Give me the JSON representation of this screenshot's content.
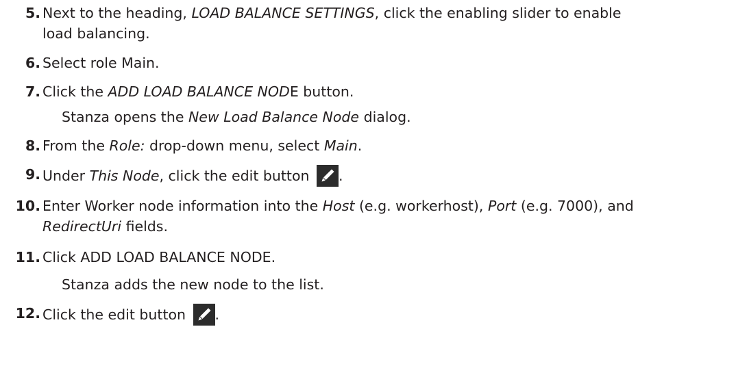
{
  "steps": [
    {
      "number": "5.",
      "parts": [
        {
          "t": "Next to the heading, "
        },
        {
          "t": "LOAD BALANCE SETTINGS",
          "i": true
        },
        {
          "t": ", click the enabling slider to enable"
        }
      ],
      "line2": [
        {
          "t": "load balancing."
        }
      ]
    },
    {
      "number": "6.",
      "parts": [
        {
          "t": "Select role Main."
        }
      ]
    },
    {
      "number": "7.",
      "parts": [
        {
          "t": "Click the "
        },
        {
          "t": "ADD LOAD BALANCE NOD",
          "i": true
        },
        {
          "t": "E button."
        }
      ],
      "result": [
        {
          "t": "Stanza opens the "
        },
        {
          "t": "New Load Balance Node",
          "i": true
        },
        {
          "t": " dialog."
        }
      ]
    },
    {
      "number": "8.",
      "parts": [
        {
          "t": "From the "
        },
        {
          "t": "Role:",
          "i": true
        },
        {
          "t": " drop-down menu, select "
        },
        {
          "t": "Main",
          "i": true
        },
        {
          "t": "."
        }
      ]
    },
    {
      "number": "9.",
      "parts": [
        {
          "t": "Under "
        },
        {
          "t": "This Node",
          "i": true
        },
        {
          "t": ", click the edit button "
        }
      ],
      "after_icon": "."
    },
    {
      "number": "10.",
      "parts": [
        {
          "t": "Enter Worker node information into the "
        },
        {
          "t": "Host",
          "i": true
        },
        {
          "t": " (e.g. workerhost), "
        },
        {
          "t": "Port",
          "i": true
        },
        {
          "t": " (e.g. 7000), and"
        }
      ],
      "line2": [
        {
          "t": "RedirectUri",
          "i": true
        },
        {
          "t": " fields."
        }
      ]
    },
    {
      "number": "11.",
      "parts": [
        {
          "t": "Click ADD LOAD BALANCE NODE."
        }
      ],
      "result": [
        {
          "t": "Stanza adds the new node to the list."
        }
      ]
    },
    {
      "number": "12.",
      "parts": [
        {
          "t": "Click the edit button "
        }
      ],
      "after_icon": "."
    }
  ],
  "icons": {
    "edit": "pencil-icon",
    "edit_button_bg": "#2c2c2c",
    "pencil_color": "#ffffff"
  }
}
